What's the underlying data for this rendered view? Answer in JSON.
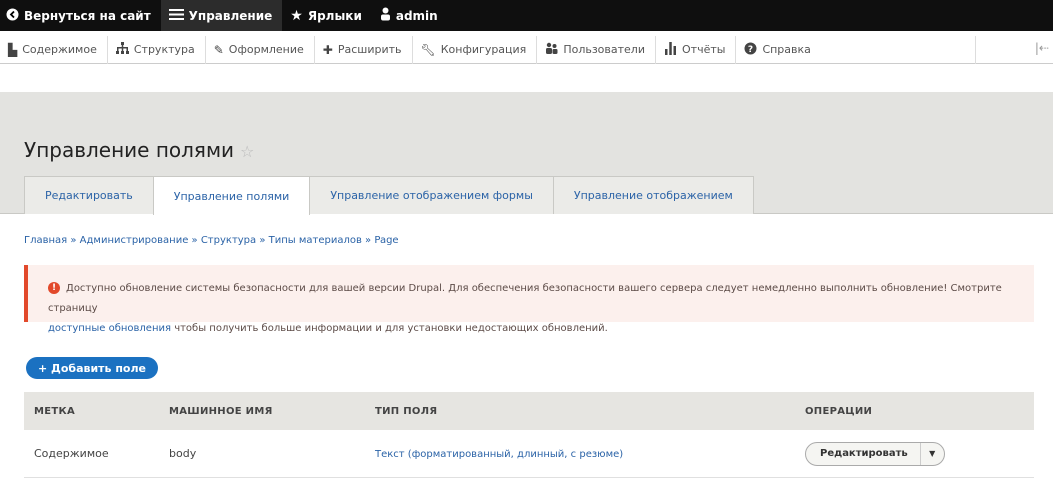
{
  "toolbar": {
    "back_label": "Вернуться на сайт",
    "manage_label": "Управление",
    "shortcuts_label": "Ярлыки",
    "user_label": "admin"
  },
  "tray": {
    "items": [
      {
        "label": "Содержимое",
        "icon": "page-icon"
      },
      {
        "label": "Структура",
        "icon": "structure-icon"
      },
      {
        "label": "Оформление",
        "icon": "brush-icon"
      },
      {
        "label": "Расширить",
        "icon": "puzzle-icon"
      },
      {
        "label": "Конфигурация",
        "icon": "wrench-icon"
      },
      {
        "label": "Пользователи",
        "icon": "people-icon"
      },
      {
        "label": "Отчёты",
        "icon": "bar-chart-icon"
      },
      {
        "label": "Справка",
        "icon": "help-icon"
      }
    ]
  },
  "page": {
    "title": "Управление полями"
  },
  "tabs": [
    {
      "label": "Редактировать"
    },
    {
      "label": "Управление полями"
    },
    {
      "label": "Управление отображением формы"
    },
    {
      "label": "Управление отображением"
    }
  ],
  "breadcrumb": "Главная » Администрирование » Структура » Типы материалов » Page",
  "warning": {
    "line1": "Доступно обновление системы безопасности для вашей версии Drupal. Для обеспечения безопасности вашего сервера следует немедленно выполнить обновление! Смотрите страницу",
    "link": "доступные обновления",
    "line2": " чтобы получить больше информации и для установки недостающих обновлений."
  },
  "add_field_label": "+ Добавить поле",
  "table": {
    "headers": [
      "МЕТКА",
      "МАШИННОЕ ИМЯ",
      "ТИП ПОЛЯ",
      "ОПЕРАЦИИ"
    ],
    "rows": [
      {
        "label": "Содержимое",
        "machine": "body",
        "type": "Текст (форматированный, длинный, с резюме)",
        "op": "Редактировать"
      }
    ]
  }
}
